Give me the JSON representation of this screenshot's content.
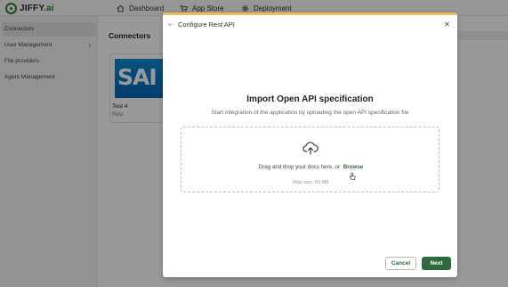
{
  "app": {
    "logo_prefix": "JIFFY",
    "logo_suffix": ".ai"
  },
  "nav": {
    "items": [
      {
        "label": "Dashboard",
        "icon": "home-icon"
      },
      {
        "label": "App Store",
        "icon": "cart-icon"
      },
      {
        "label": "Deployment",
        "icon": "gear-icon"
      }
    ]
  },
  "sidebar": {
    "items": [
      {
        "label": "Connectors",
        "active": true
      },
      {
        "label": "User Management",
        "has_chevron": true
      },
      {
        "label": "File providers"
      },
      {
        "label": "Agent Management"
      }
    ]
  },
  "main": {
    "title": "Connectors",
    "cards": [
      {
        "logo_text": "SAI",
        "name": "Test 4",
        "type": "Rest"
      }
    ]
  },
  "modal": {
    "back_icon": "arrow-left-icon",
    "title": "Configure Rest API",
    "close_icon": "close-icon",
    "heading": "Import Open API specification",
    "subheading": "Start integration of the application by uploading the open API specification file",
    "dropzone": {
      "icon": "cloud-upload-icon",
      "text": "Drag and drop your docs here, or",
      "browse_label": "Browse",
      "max_size": "Max size: 50 MB"
    },
    "cancel_label": "Cancel",
    "next_label": "Next"
  },
  "colors": {
    "primary_green": "#2e6b3c",
    "modal_accent": "#ebbd5a",
    "sap_blue": "#0a8bd6"
  }
}
